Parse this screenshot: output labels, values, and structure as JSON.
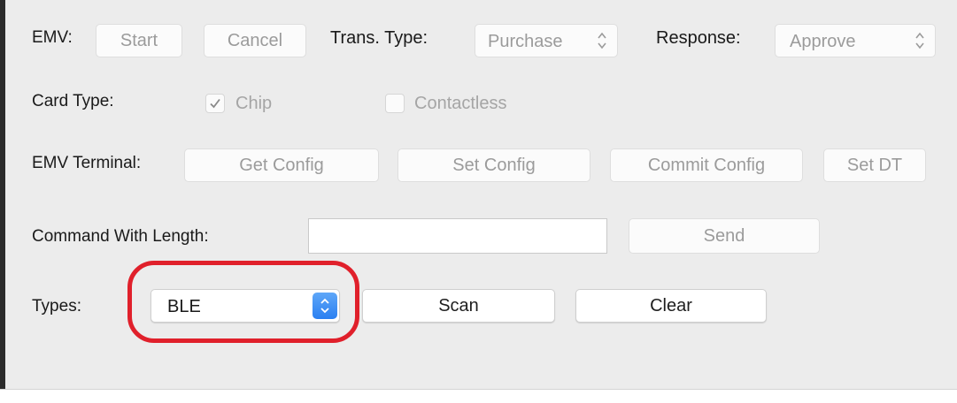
{
  "colors": {
    "panel": "#ececec",
    "disabled_text": "#9b9b9b",
    "highlight": "#e0202b",
    "accent": "#2a7ff1"
  },
  "emv": {
    "label": "EMV:",
    "start_label": "Start",
    "cancel_label": "Cancel",
    "trans_type_label": "Trans. Type:",
    "trans_type_value": "Purchase",
    "response_label": "Response:",
    "response_value": "Approve"
  },
  "card_type": {
    "label": "Card Type:",
    "chip_label": "Chip",
    "chip_checked": true,
    "contactless_label": "Contactless",
    "contactless_checked": false
  },
  "emv_terminal": {
    "label": "EMV Terminal:",
    "get_config_label": "Get Config",
    "set_config_label": "Set Config",
    "commit_config_label": "Commit Config",
    "set_dt_label": "Set DT"
  },
  "command": {
    "label": "Command With Length:",
    "value": "",
    "send_label": "Send"
  },
  "types": {
    "label": "Types:",
    "value": "BLE",
    "scan_label": "Scan",
    "clear_label": "Clear"
  },
  "icons": {
    "popup_arrows": "up-down-chevron-icon",
    "checkmark": "checkmark-icon"
  }
}
